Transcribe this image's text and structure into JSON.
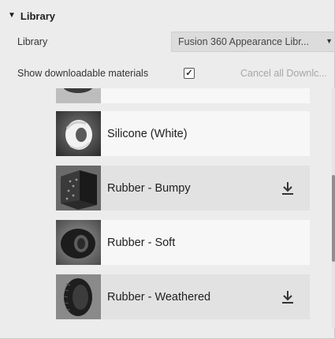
{
  "section": {
    "title": "Library"
  },
  "library_row": {
    "label": "Library",
    "selected": "Fusion 360 Appearance Libr..."
  },
  "download_row": {
    "label": "Show downloadable materials",
    "checked_glyph": "✓",
    "cancel_label": "Cancel all Downlc..."
  },
  "materials": [
    {
      "name": "",
      "thumbnail": "partial-ring",
      "downloadable": false
    },
    {
      "name": "Silicone (White)",
      "thumbnail": "white-twisted-ring",
      "downloadable": false
    },
    {
      "name": "Rubber - Bumpy",
      "thumbnail": "bumpy-rubber-cube",
      "downloadable": true
    },
    {
      "name": "Rubber - Soft",
      "thumbnail": "soft-rubber-ring",
      "downloadable": false
    },
    {
      "name": "Rubber - Weathered",
      "thumbnail": "weathered-tire",
      "downloadable": true
    }
  ],
  "icons": {
    "download": "download-icon",
    "collapse": "triangle-down-icon",
    "dropdown": "chevron-down-icon"
  }
}
